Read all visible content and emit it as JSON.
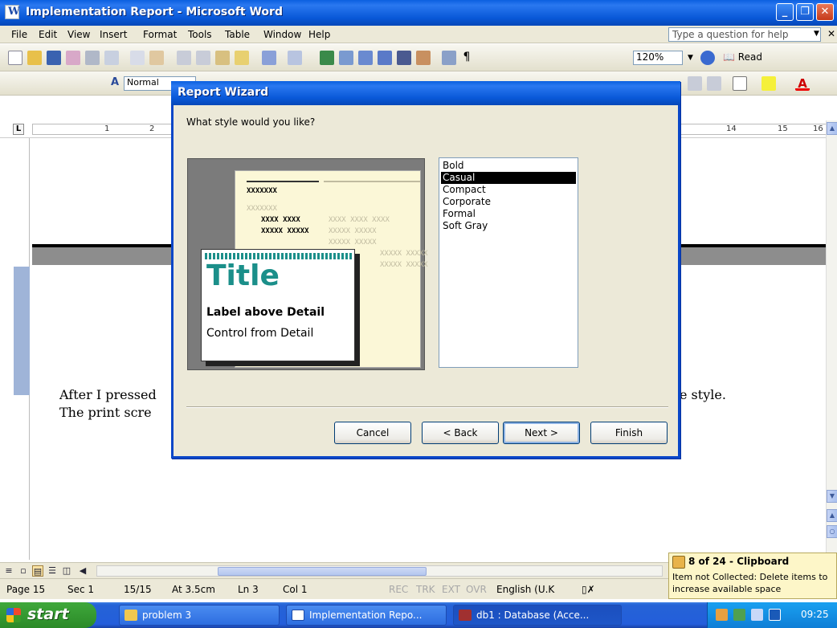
{
  "top_text": "The print screen below shows the option that came up.",
  "window": {
    "title": "Implementation Report - Microsoft Word"
  },
  "menu": {
    "items": [
      "File",
      "Edit",
      "View",
      "Insert",
      "Format",
      "Tools",
      "Table",
      "Window",
      "Help"
    ],
    "help_placeholder": "Type a question for help"
  },
  "toolbar": {
    "zoom": "120%",
    "read_label": "Read",
    "style": "Normal"
  },
  "ruler": {
    "numbers": [
      "1",
      "2",
      "14",
      "15",
      "16"
    ]
  },
  "document": {
    "line1_left": "After I pressed",
    "line1_right": "e style.",
    "line2_left": "The print scre"
  },
  "status": {
    "page": "Page 15",
    "sec": "Sec 1",
    "pages": "15/15",
    "at": "At 3.5cm",
    "ln": "Ln 3",
    "col": "Col 1",
    "rec": "REC",
    "trk": "TRK",
    "ext": "EXT",
    "ovr": "OVR",
    "language": "English (U.K"
  },
  "clipboard": {
    "title": "8 of 24 - Clipboard",
    "message": "Item not Collected: Delete items to increase available space"
  },
  "taskbar": {
    "start": "start",
    "tasks": [
      "problem 3",
      "Implementation Repo...",
      "db1 : Database (Acce..."
    ],
    "clock": "09:25"
  },
  "wizard": {
    "title": "Report Wizard",
    "question": "What style would you like?",
    "styles": [
      "Bold",
      "Casual",
      "Compact",
      "Corporate",
      "Formal",
      "Soft Gray"
    ],
    "selected_style": "Casual",
    "preview": {
      "title": "Title",
      "label": "Label above Detail",
      "control": "Control from Detail",
      "placeholder_bold": "XXXXXXX",
      "placeholder_faint": "XXXXXXX",
      "placeholder_pair": "XXXX XXXX",
      "placeholder_row": "XXXXX XXXXX",
      "placeholder_faint_pair": "XXXX XXXX XXXX",
      "placeholder_faint_row": "XXXXX XXXXX"
    },
    "buttons": {
      "cancel": "Cancel",
      "back": "< Back",
      "next": "Next >",
      "finish": "Finish"
    }
  }
}
